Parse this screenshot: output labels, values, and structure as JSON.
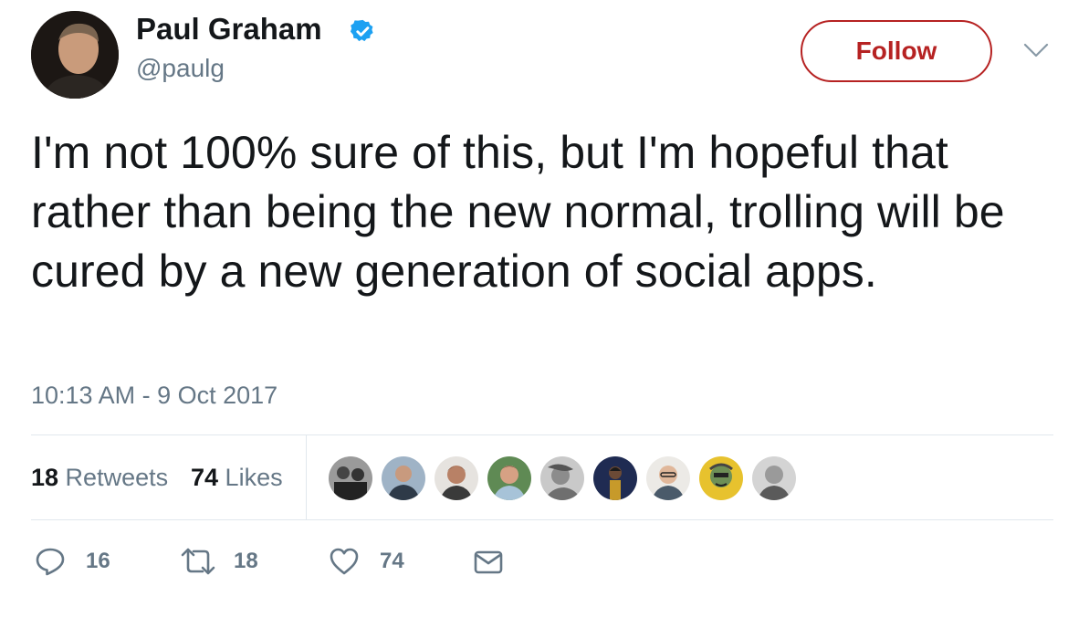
{
  "author": {
    "display_name": "Paul Graham",
    "username": "@paulg",
    "avatar_icon": "avatar",
    "verified_icon": "verified-badge-icon",
    "verified_color": "#1da1f2"
  },
  "follow_button": {
    "label": "Follow",
    "color": "#b62222"
  },
  "menu_icon": "chevron-down-icon",
  "tweet": {
    "text": "I'm not 100% sure of this, but I'm hopeful that rather than being the new normal, trolling will be cured by a new generation of social apps.",
    "timestamp": "10:13 AM - 9 Oct 2017"
  },
  "stats": {
    "retweets_count": "18",
    "retweets_label": " Retweets",
    "likes_count": "74",
    "likes_label": " Likes"
  },
  "likers": [
    {
      "name": "liker-avatar-1",
      "bg": "#8a8a8a"
    },
    {
      "name": "liker-avatar-2",
      "bg": "#5e6f80"
    },
    {
      "name": "liker-avatar-3",
      "bg": "#8b6a58"
    },
    {
      "name": "liker-avatar-4",
      "bg": "#4f7a4a"
    },
    {
      "name": "liker-avatar-5",
      "bg": "#b0b0b0"
    },
    {
      "name": "liker-avatar-6",
      "bg": "#2a2a3a"
    },
    {
      "name": "liker-avatar-7",
      "bg": "#c9b59a"
    },
    {
      "name": "liker-avatar-8",
      "bg": "#e3c232"
    },
    {
      "name": "liker-avatar-9",
      "bg": "#7d7d7d"
    }
  ],
  "actions": {
    "reply_count": "16",
    "retweet_count": "18",
    "like_count": "74",
    "reply_icon": "reply-icon",
    "retweet_icon": "retweet-icon",
    "like_icon": "heart-icon",
    "dm_icon": "envelope-icon",
    "icon_color": "#657786"
  }
}
